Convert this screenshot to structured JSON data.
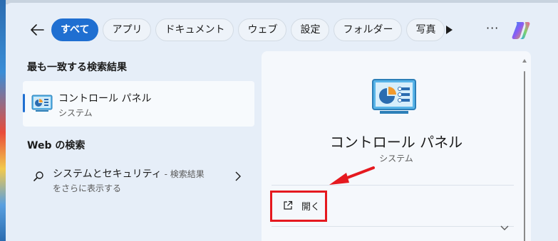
{
  "header": {
    "tabs": [
      {
        "label": "すべて",
        "active": true
      },
      {
        "label": "アプリ",
        "active": false
      },
      {
        "label": "ドキュメント",
        "active": false
      },
      {
        "label": "ウェブ",
        "active": false
      },
      {
        "label": "設定",
        "active": false
      },
      {
        "label": "フォルダー",
        "active": false
      },
      {
        "label": "写真",
        "active": false
      }
    ],
    "more_label": "···",
    "accent_color": "#1f6fd1"
  },
  "best_match": {
    "heading": "最も一致する検索結果",
    "item": {
      "title": "コントロール パネル",
      "subtitle": "システム",
      "icon": "control-panel-icon"
    }
  },
  "web_search": {
    "heading": "Web の検索",
    "item": {
      "query": "システムとセキュリティ",
      "suffix": " - 検索結果",
      "line2": "をさらに表示する",
      "icon": "search-icon"
    }
  },
  "detail": {
    "title": "コントロール パネル",
    "subtitle": "システム",
    "actions": [
      {
        "label": "開く",
        "icon": "external-link-icon"
      }
    ]
  },
  "annotation": {
    "highlight_color": "#e5191f"
  }
}
